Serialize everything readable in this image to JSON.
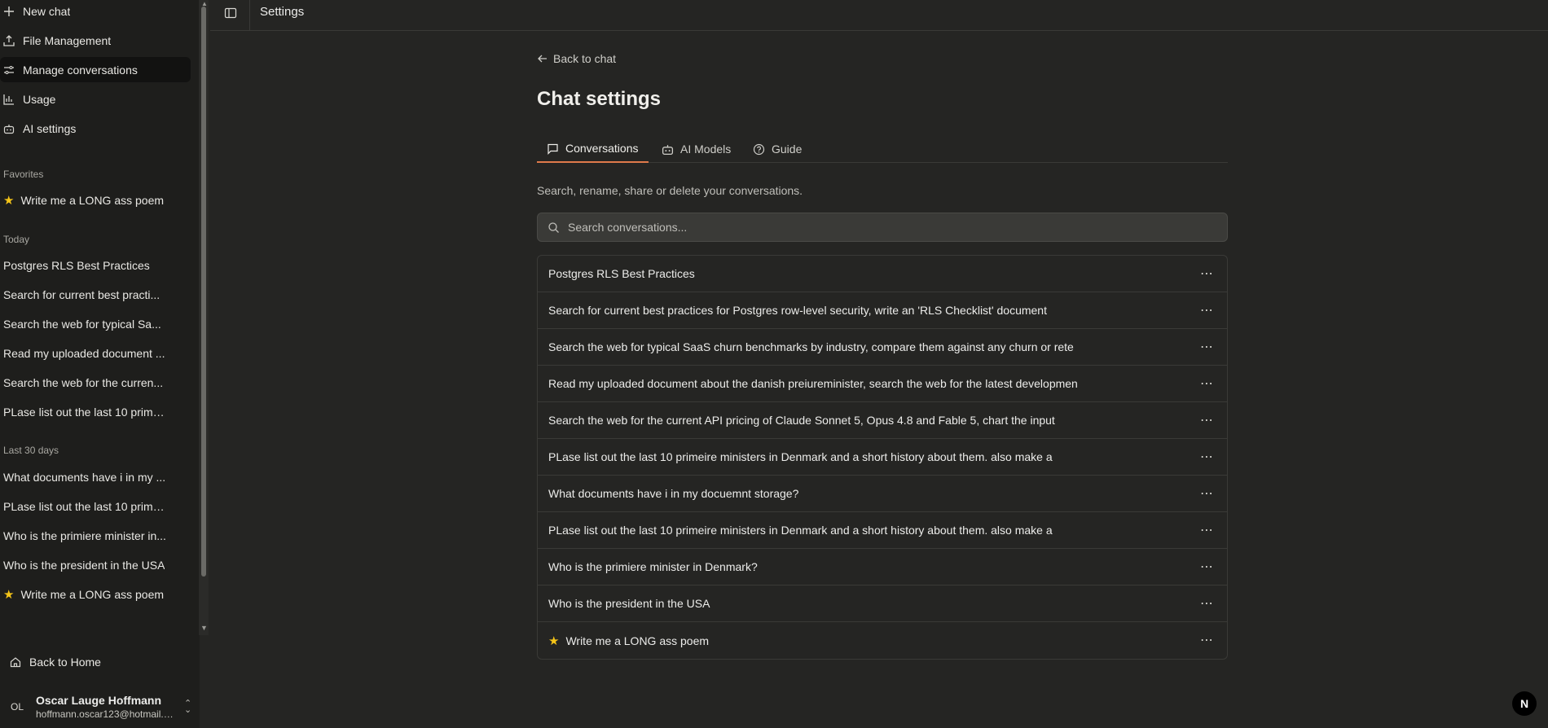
{
  "sidebar": {
    "nav": [
      {
        "label": "New chat",
        "icon": "plus-icon"
      },
      {
        "label": "File Management",
        "icon": "upload-icon"
      },
      {
        "label": "Manage conversations",
        "icon": "sliders-icon"
      },
      {
        "label": "Usage",
        "icon": "bar-chart-icon"
      },
      {
        "label": "AI settings",
        "icon": "bot-icon"
      }
    ],
    "favorites_label": "Favorites",
    "favorites": [
      "Write me a LONG ass poem"
    ],
    "today_label": "Today",
    "today": [
      "Postgres RLS Best Practices",
      "Search for current best practi...",
      "Search the web for typical Sa...",
      "Read my uploaded document ...",
      "Search the web for the curren...",
      "PLase list out the last 10 primei..."
    ],
    "last30_label": "Last 30 days",
    "last30": [
      "What documents have i in my ...",
      "PLase list out the last 10 prime...",
      "Who is the primiere minister in...",
      "Who is the president in the USA",
      "Write me a LONG ass poem"
    ],
    "back_home": "Back to Home",
    "user": {
      "initials": "OL",
      "name": "Oscar Lauge Hoffmann",
      "email": "hoffmann.oscar123@hotmail.c..."
    }
  },
  "topbar": {
    "title": "Settings"
  },
  "main": {
    "back_label": "Back to chat",
    "title": "Chat settings",
    "tabs": [
      {
        "label": "Conversations",
        "icon": "message-square-icon"
      },
      {
        "label": "AI Models",
        "icon": "bot-icon"
      },
      {
        "label": "Guide",
        "icon": "help-circle-icon"
      }
    ],
    "subtitle": "Search, rename, share or delete your conversations.",
    "search_placeholder": "Search conversations...",
    "conversations": [
      "Postgres RLS Best Practices",
      "Search for current best practices for Postgres row-level security, write an 'RLS Checklist' document",
      "Search the web for typical SaaS churn benchmarks by industry, compare them against any churn or rete",
      "Read my uploaded document about the danish preiureminister, search the web for the latest developmen",
      "Search the web for the current API pricing of Claude Sonnet 5, Opus 4.8 and Fable 5, chart the input",
      "PLase list out the last 10 primeire ministers in Denmark and a short history about them. also make a",
      "What documents have i in my docuemnt storage?",
      "PLase list out the last 10 primeire ministers in Denmark and a short history about them. also make a",
      "Who is the primiere minister in Denmark?",
      "Who is the president in the USA",
      "Write me a LONG ass poem"
    ],
    "more_label": "⋯"
  },
  "badge": "N",
  "colors": {
    "accent": "#e07a4b",
    "star": "#f5c518",
    "background": "#252523",
    "sidebar": "#1e1e1c"
  }
}
